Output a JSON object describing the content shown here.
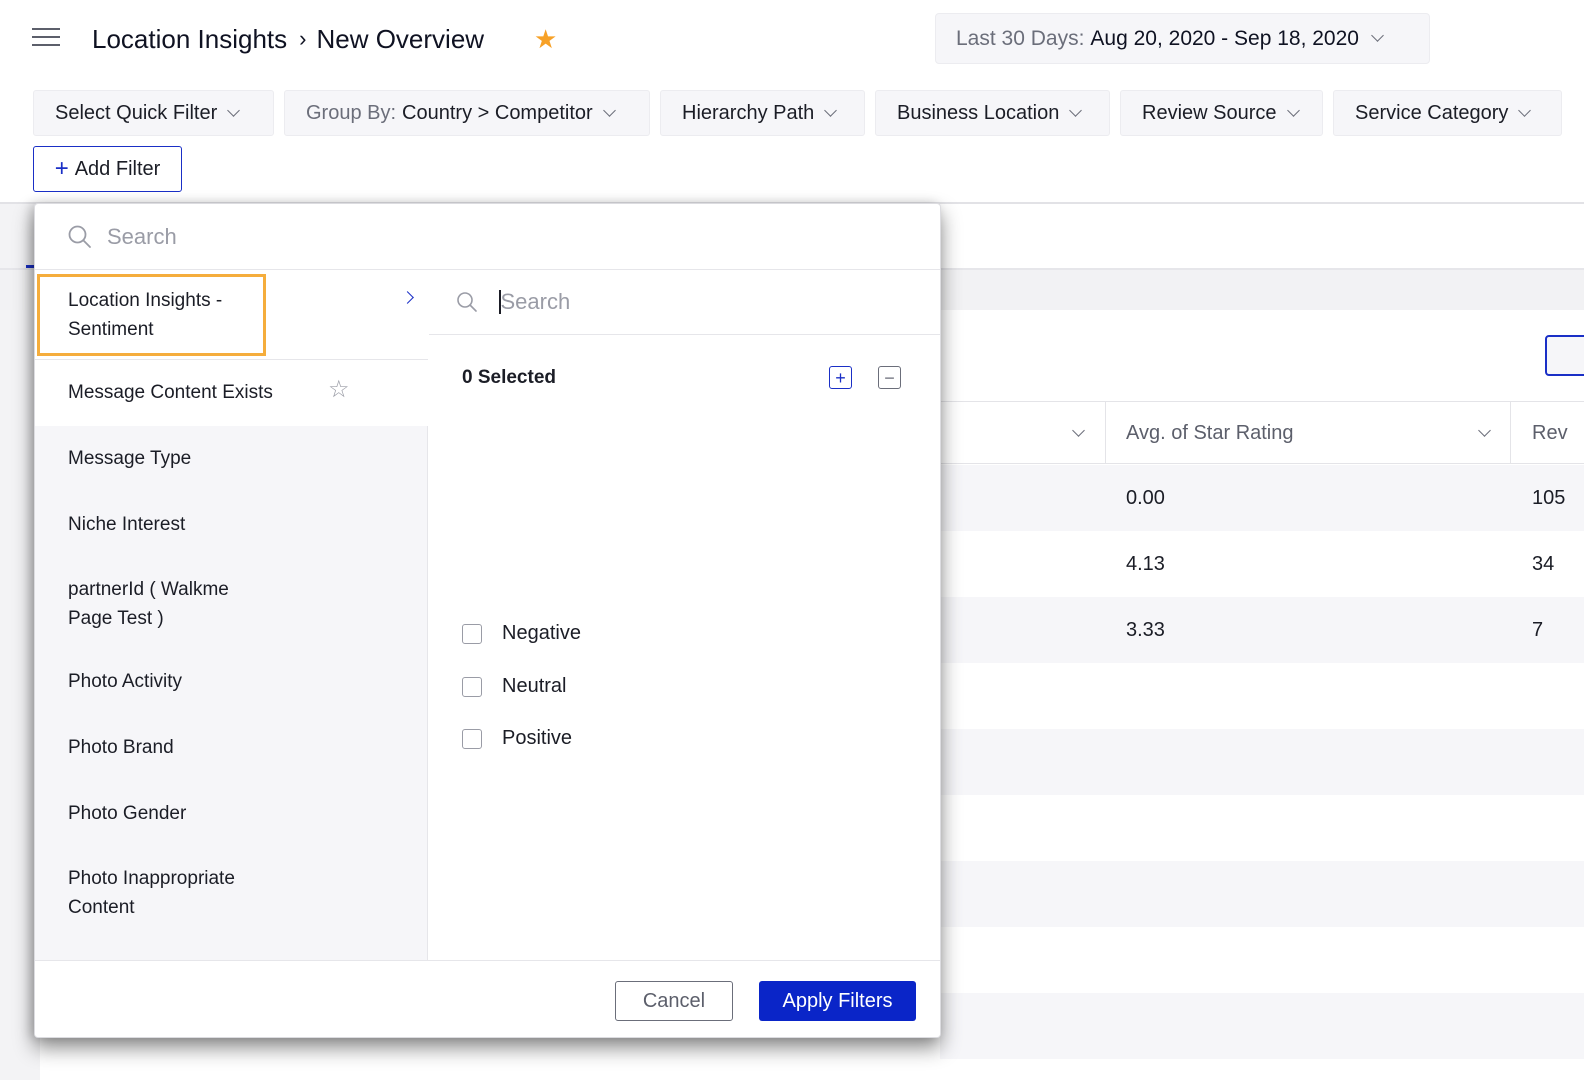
{
  "header": {
    "breadcrumb": [
      "Location Insights",
      "New Overview"
    ],
    "favorite": true,
    "date_range": {
      "label": "Last 30 Days:",
      "value": "Aug 20, 2020 - Sep 18, 2020"
    }
  },
  "filters": {
    "chips": [
      {
        "label": "Select Quick Filter",
        "prefix": ""
      },
      {
        "label": "Country > Competitor",
        "prefix": "Group By:"
      },
      {
        "label": "Hierarchy Path",
        "prefix": ""
      },
      {
        "label": "Business Location",
        "prefix": ""
      },
      {
        "label": "Review Source",
        "prefix": ""
      },
      {
        "label": "Service Category",
        "prefix": ""
      }
    ],
    "add_filter_label": "Add Filter"
  },
  "table": {
    "columns": [
      "Avg. of Star Rating",
      "Rev"
    ],
    "rows": [
      {
        "avg_star_rating": "0.00",
        "reviews": "105"
      },
      {
        "avg_star_rating": "4.13",
        "reviews": "34"
      },
      {
        "avg_star_rating": "3.33",
        "reviews": "7"
      }
    ]
  },
  "popup": {
    "search_placeholder": "Search",
    "list_items": [
      "Location Insights - Sentiment",
      "Message Content Exists",
      "Message Type",
      "Niche Interest",
      "partnerId ( Walkme Page Test )",
      "Photo Activity",
      "Photo Brand",
      "Photo Gender",
      "Photo Inappropriate Content"
    ],
    "active_item": "Location Insights - Sentiment",
    "sub_search_placeholder": "Search",
    "selected_count_label": "0 Selected",
    "options": [
      {
        "label": "Negative",
        "checked": false
      },
      {
        "label": "Neutral",
        "checked": false
      },
      {
        "label": "Positive",
        "checked": false
      }
    ],
    "cancel_label": "Cancel",
    "apply_label": "Apply Filters"
  },
  "colors": {
    "accent": "#0a25c8",
    "highlight": "#f5ad3c",
    "favorite_star": "#f7a127"
  }
}
